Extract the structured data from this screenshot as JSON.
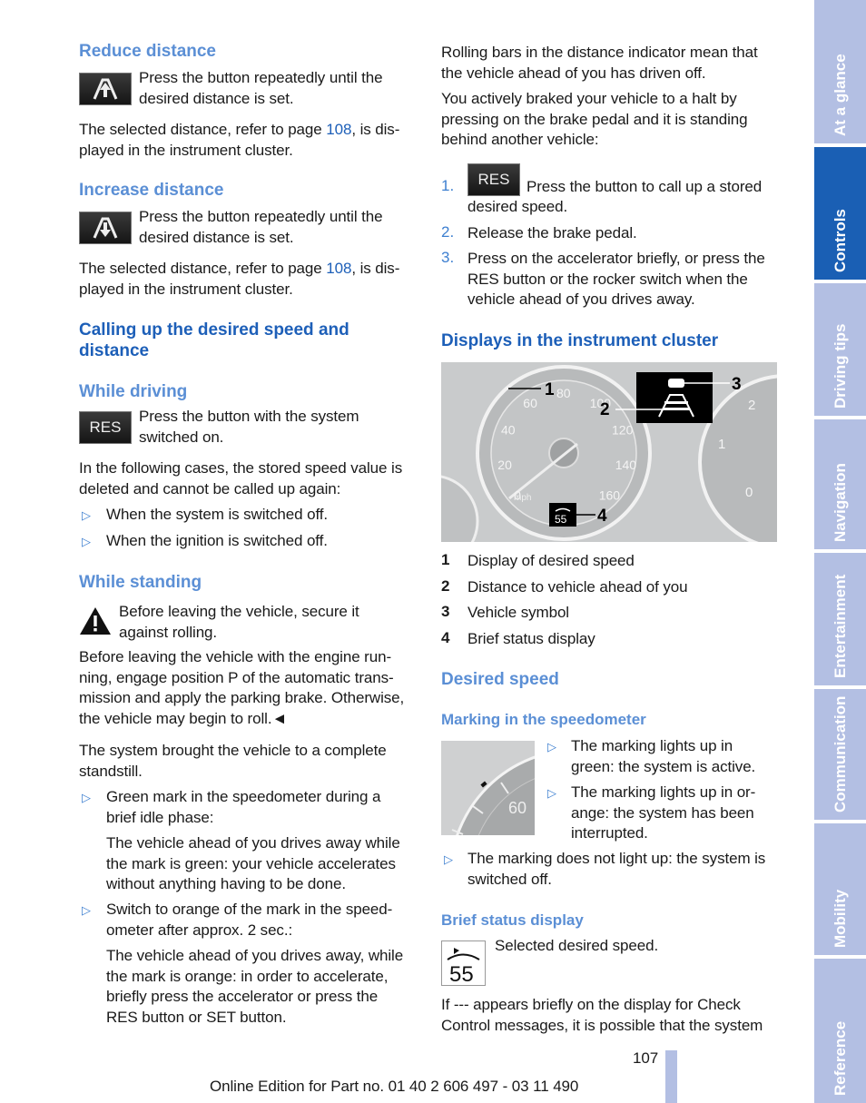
{
  "left": {
    "reduce_heading": "Reduce distance",
    "reduce_text": "Press the button repeatedly until the\ndesired distance is set.",
    "reduce_para_a": "The selected distance, refer to page ",
    "reduce_para_link": "108",
    "reduce_para_b": ", is dis-",
    "reduce_para_c": "played in the instrument cluster.",
    "increase_heading": "Increase distance",
    "increase_text": "Press the button repeatedly until the\ndesired distance is set.",
    "increase_para_a": "The selected distance, refer to page ",
    "increase_para_link": "108",
    "increase_para_b": ", is dis-",
    "increase_para_c": "played in the instrument cluster.",
    "calling_heading": "Calling up the desired speed and\ndistance",
    "driving_heading": "While driving",
    "res_label": "RES",
    "driving_text": "Press the button with the system\nswitched on.",
    "deleted_para": "In the following cases, the stored speed value is\ndeleted and cannot be called up again:",
    "bullets": [
      "When the system is switched off.",
      "When the ignition is switched off."
    ],
    "standing_heading": "While standing",
    "warning_text": "Before leaving the vehicle, secure it\nagainst rolling.",
    "engine_para": "Before leaving the vehicle with the engine run-\nning, engage position P of the automatic trans-\nmission and apply the parking brake. Otherwise,\nthe vehicle may begin to roll.◄",
    "standstill_para": "The system brought the vehicle to a complete\nstandstill.",
    "bullet_green": "Green mark in the speedometer during a\nbrief idle phase:",
    "green_detail": "The vehicle ahead of you drives away while\nthe mark is green: your vehicle accelerates\nwithout anything having to be done.",
    "bullet_orange": "Switch to orange of the mark in the speed-\nometer after approx. 2 sec.:",
    "orange_detail": "The vehicle ahead of you drives away, while\nthe mark is orange: in order to accelerate,\nbriefly press the accelerator or press the\nRES button or SET button."
  },
  "right": {
    "rolling_para": "Rolling bars in the distance indicator mean that\nthe vehicle ahead of you has driven off.",
    "braked_para": "You actively braked your vehicle to a halt by\npressing on the brake pedal and it is standing\nbehind another vehicle:",
    "steps": [
      {
        "num": "1.",
        "text_first": "Press the button to call up a stored",
        "text_rest": "desired speed."
      },
      {
        "num": "2.",
        "text": "Release the brake pedal."
      },
      {
        "num": "3.",
        "text": "Press on the accelerator briefly, or press the\nRES button or the rocker switch when the\nvehicle ahead of you drives away."
      }
    ],
    "res_label": "RES",
    "displays_heading": "Displays in the instrument cluster",
    "cluster": {
      "callouts": [
        "1",
        "2",
        "3",
        "4"
      ],
      "speed_mph": [
        "0",
        "20",
        "40",
        "60",
        "80",
        "100",
        "120",
        "140",
        "160"
      ],
      "unit_mph": "mph",
      "status_value": "55",
      "tacho": [
        "0",
        "1",
        "2"
      ]
    },
    "legend": [
      {
        "num": "1",
        "text": "Display of desired speed"
      },
      {
        "num": "2",
        "text": "Distance to vehicle ahead of you"
      },
      {
        "num": "3",
        "text": "Vehicle symbol"
      },
      {
        "num": "4",
        "text": "Brief status display"
      }
    ],
    "desired_heading": "Desired speed",
    "marking_heading": "Marking in the speedometer",
    "marking_image_value": "60",
    "marking_bullets": [
      "The marking lights up in\ngreen: the system is active.",
      "The marking lights up in or-\nange: the system has been\ninterrupted."
    ],
    "marking_off": "The marking does not light up: the system is\nswitched off.",
    "brief_heading": "Brief status display",
    "brief_icon_value": "55",
    "brief_text": "Selected desired speed.",
    "check_para": "If --- appears briefly on the display for Check\nControl messages, it is possible that the system"
  },
  "footer": {
    "page_number": "107",
    "edition": "Online Edition for Part no. 01 40 2 606 497 - 03 11 490"
  },
  "sidebar": {
    "tabs": [
      {
        "label": "At a glance",
        "active": false
      },
      {
        "label": "Controls",
        "active": true
      },
      {
        "label": "Driving tips",
        "active": false
      },
      {
        "label": "Navigation",
        "active": false
      },
      {
        "label": "Entertainment",
        "active": false
      },
      {
        "label": "Communication",
        "active": false
      },
      {
        "label": "Mobility",
        "active": false
      },
      {
        "label": "Reference",
        "active": false
      }
    ]
  },
  "colors": {
    "heading": "#5b8fd5",
    "heading_dark": "#1d5fb8",
    "tab": "#b3bfe3",
    "tab_active": "#1a5fb4",
    "link": "#1d5fb8"
  }
}
